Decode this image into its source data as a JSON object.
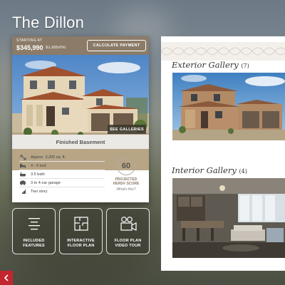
{
  "title": "The Dillon",
  "price": {
    "label": "STARTING AT",
    "amount": "$345,990",
    "monthly": "$1,695/mo",
    "calc_button": "CALCULATE PAYMENT"
  },
  "photo": {
    "galleries_button": "SEE GALLERIES"
  },
  "floorplan_name": "Finished Basement",
  "specs": [
    {
      "icon": "square-footage-icon",
      "text": "Approx. 3,200 sq. ft."
    },
    {
      "icon": "bed-icon",
      "text": "4 - 6 bed"
    },
    {
      "icon": "bath-icon",
      "text": "3.5 bath"
    },
    {
      "icon": "car-icon",
      "text": "3 to 4-car garage"
    },
    {
      "icon": "stairs-icon",
      "text": "Two story"
    }
  ],
  "hers": {
    "score": "60",
    "label_line1": "PROJECTED",
    "label_line2": "HERS® SCORE",
    "link": "What's this?"
  },
  "tiles": [
    {
      "line1": "INCLUDED",
      "line2": "FEATURES"
    },
    {
      "line1": "INTERACTIVE",
      "line2": "FLOOR PLAN"
    },
    {
      "line1": "FLOOR PLAN",
      "line2": "VIDEO TOUR"
    }
  ],
  "galleries": {
    "exterior": {
      "title": "Exterior Gallery",
      "count": "(7)"
    },
    "interior": {
      "title": "Interior Gallery",
      "count": "(4)"
    }
  },
  "colors": {
    "accent": "#8b7b68",
    "back_button": "#c4262e"
  }
}
